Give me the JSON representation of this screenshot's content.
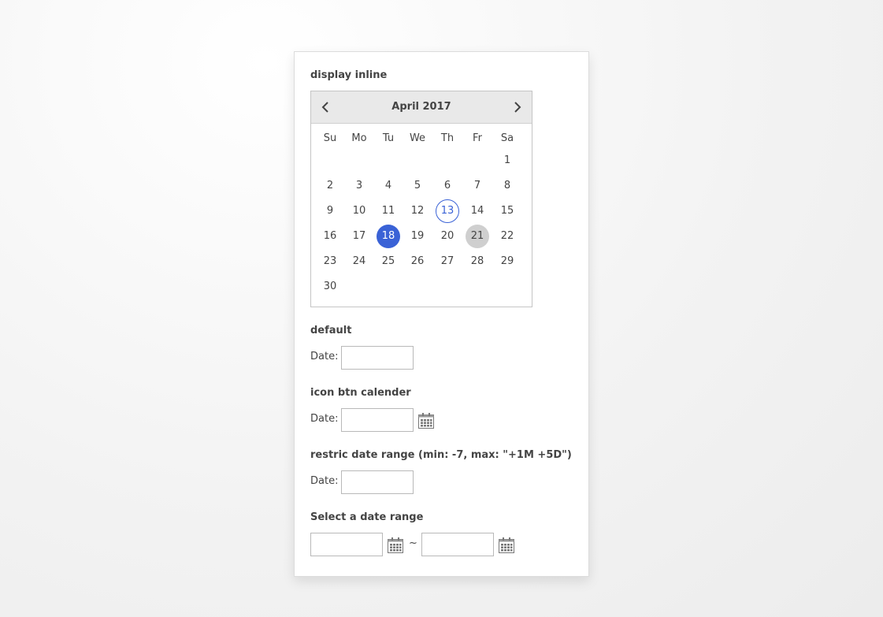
{
  "sections": {
    "inline": {
      "title": "display inline"
    },
    "default": {
      "title": "default",
      "date_label": "Date:",
      "value": ""
    },
    "icon_btn": {
      "title": "icon btn calender",
      "date_label": "Date:",
      "value": "",
      "icon": "calendar-icon"
    },
    "restrict": {
      "title": "restric date range (min: -7, max: \"+1M +5D\")",
      "date_label": "Date:",
      "value": ""
    },
    "range": {
      "title": "Select a date range",
      "separator": "~",
      "from_value": "",
      "to_value": "",
      "icon": "calendar-icon"
    }
  },
  "calendar": {
    "month_title": "April 2017",
    "prev_icon": "chevron-left-icon",
    "next_icon": "chevron-right-icon",
    "weekdays": [
      "Su",
      "Mo",
      "Tu",
      "We",
      "Th",
      "Fr",
      "Sa"
    ],
    "first_weekday_index": 6,
    "days_in_month": 30,
    "today": 13,
    "selected": 18,
    "highlighted": 21,
    "colors": {
      "selected": "#3a62d6",
      "today_ring": "#3a62d6",
      "highlight": "#cfcfcf",
      "header_bg": "#e9e9e9"
    }
  }
}
